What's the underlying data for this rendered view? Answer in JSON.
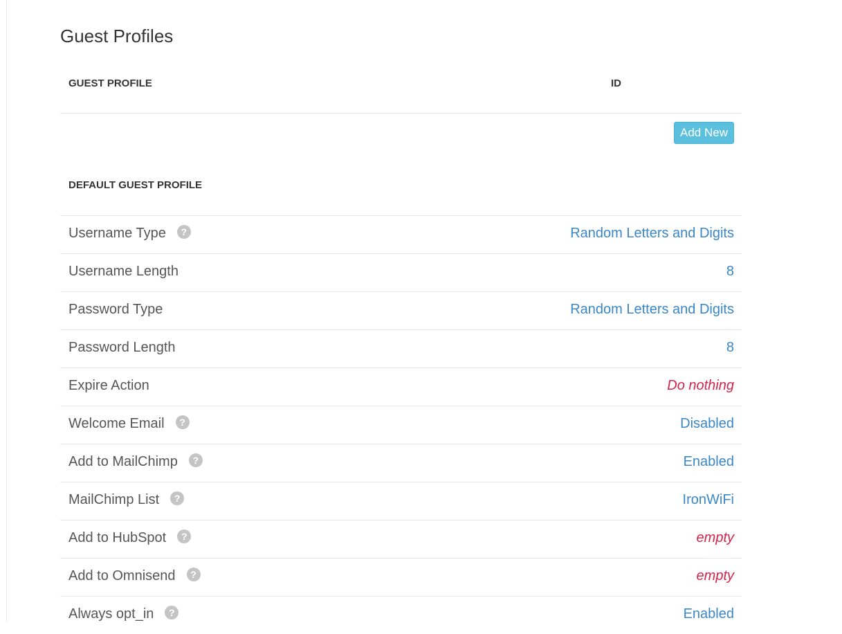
{
  "page": {
    "title": "Guest Profiles"
  },
  "table": {
    "headers": {
      "guest_profile": "GUEST PROFILE",
      "id": "ID"
    },
    "add_new_label": "Add New"
  },
  "section": {
    "title": "DEFAULT GUEST PROFILE"
  },
  "settings": [
    {
      "label": "Username Type",
      "value": "Random Letters and Digits",
      "help": true,
      "empty": false
    },
    {
      "label": "Username Length",
      "value": "8",
      "help": false,
      "empty": false
    },
    {
      "label": "Password Type",
      "value": "Random Letters and Digits",
      "help": false,
      "empty": false
    },
    {
      "label": "Password Length",
      "value": "8",
      "help": false,
      "empty": false
    },
    {
      "label": "Expire Action",
      "value": "Do nothing",
      "help": false,
      "empty": true
    },
    {
      "label": "Welcome Email",
      "value": "Disabled",
      "help": true,
      "empty": false
    },
    {
      "label": "Add to MailChimp",
      "value": "Enabled",
      "help": true,
      "empty": false
    },
    {
      "label": "MailChimp List",
      "value": "IronWiFi",
      "help": true,
      "empty": false
    },
    {
      "label": "Add to HubSpot",
      "value": "empty",
      "help": true,
      "empty": true
    },
    {
      "label": "Add to Omnisend",
      "value": "empty",
      "help": true,
      "empty": true
    },
    {
      "label": "Always opt_in",
      "value": "Enabled",
      "help": true,
      "empty": false
    }
  ],
  "icons": {
    "help": "question-circle-icon"
  },
  "colors": {
    "link": "#3a87c8",
    "empty": "#d6234a",
    "button": "#5bc0de"
  }
}
